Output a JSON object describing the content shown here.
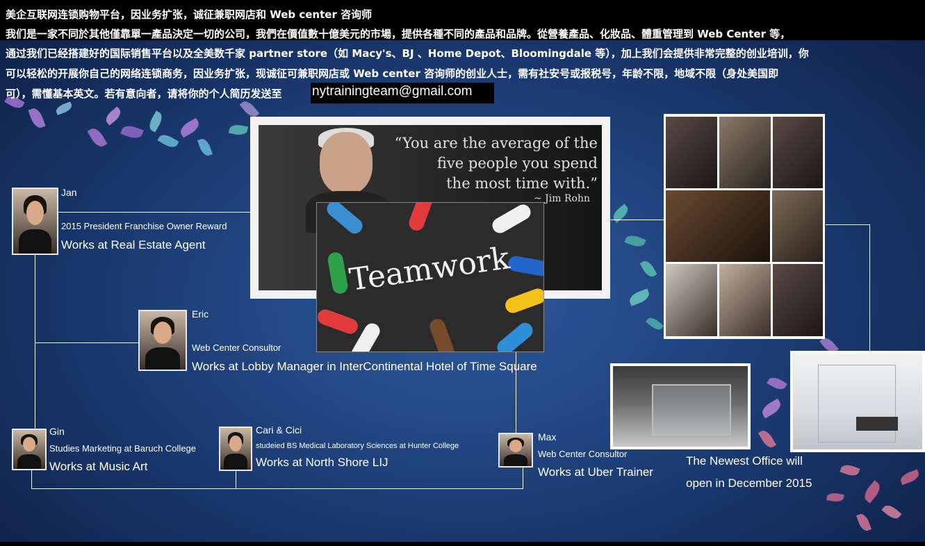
{
  "header": {
    "line1": "美企互联网连锁购物平台，因业务扩张，诚征兼职网店和 Web center 咨询师",
    "line2": "我们是一家不同於其他僅靠單一產品決定一切的公司，我們在價值數十億美元的市場，提供各種不同的產品和品牌。從營養產品、化妝品、體重管理到 Web Center 等，",
    "line3": "通过我们已经搭建好的国际销售平台以及全美数千家 partner store（如 Macy's、BJ 、Home Depot、Bloomingdale 等），加上我们会提供非常完整的创业培训，你",
    "line4": "可以轻松的开展你自己的网络连锁商务，因业务扩张，现诚征可兼职网店或 Web center 咨询师的创业人士，需有社安号或报税号，年龄不限，地域不限（身处美国即",
    "line5": "可），需懂基本英文。若有意向者，请将你的个人简历发送至",
    "email": "nytrainingteam@gmail.com"
  },
  "quote": {
    "line1": "“You are the average of the",
    "line2": "five people you spend",
    "line3": "the most time with.”",
    "author": "~ Jim Rohn"
  },
  "teamwork": {
    "word": "Teamwork"
  },
  "people": [
    {
      "name": "Jan",
      "role": "2015 President Franchise Owner Reward",
      "work": "Works at Real Estate Agent"
    },
    {
      "name": "Eric",
      "role": "Web Center Consultor",
      "work": "Works at Lobby Manager in InterContinental Hotel of Time Square"
    },
    {
      "name": "Gin",
      "role": "Studies Marketing at Baruch College",
      "work": "Works at Music Art"
    },
    {
      "name": "Cari & Cici",
      "role": "studeied BS Medical Laboratory Sciences at Hunter College",
      "work": "Works at North Shore LIJ"
    },
    {
      "name": "Max",
      "role": "Web Center Consultor",
      "work": "Works at Uber Trainer"
    }
  ],
  "office": {
    "caption1": "The Newest Office  will",
    "caption2": "open in December 2015"
  },
  "colors": {
    "background": "#1f427d",
    "leaf_purple": "#b07ad8",
    "leaf_teal": "#5ec6b8",
    "leaf_pink": "#e07a9a"
  }
}
